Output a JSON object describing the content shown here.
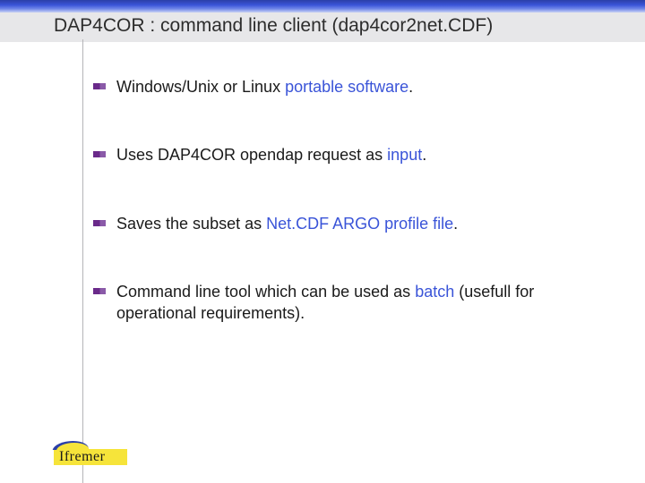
{
  "title": "DAP4COR : command line client (dap4cor2net.CDF)",
  "bullets": [
    {
      "pre": "Windows/Unix or Linux ",
      "hl": "portable software",
      "post": "."
    },
    {
      "pre": "Uses DAP4COR opendap request as ",
      "hl": "input",
      "post": "."
    },
    {
      "pre": "Saves the subset as ",
      "hl": "Net.CDF ARGO profile file",
      "post": "."
    },
    {
      "pre": "Command line tool which can be used as ",
      "hl": "batch",
      "post": " (usefull for operational requirements)."
    }
  ],
  "logo": "Ifremer"
}
